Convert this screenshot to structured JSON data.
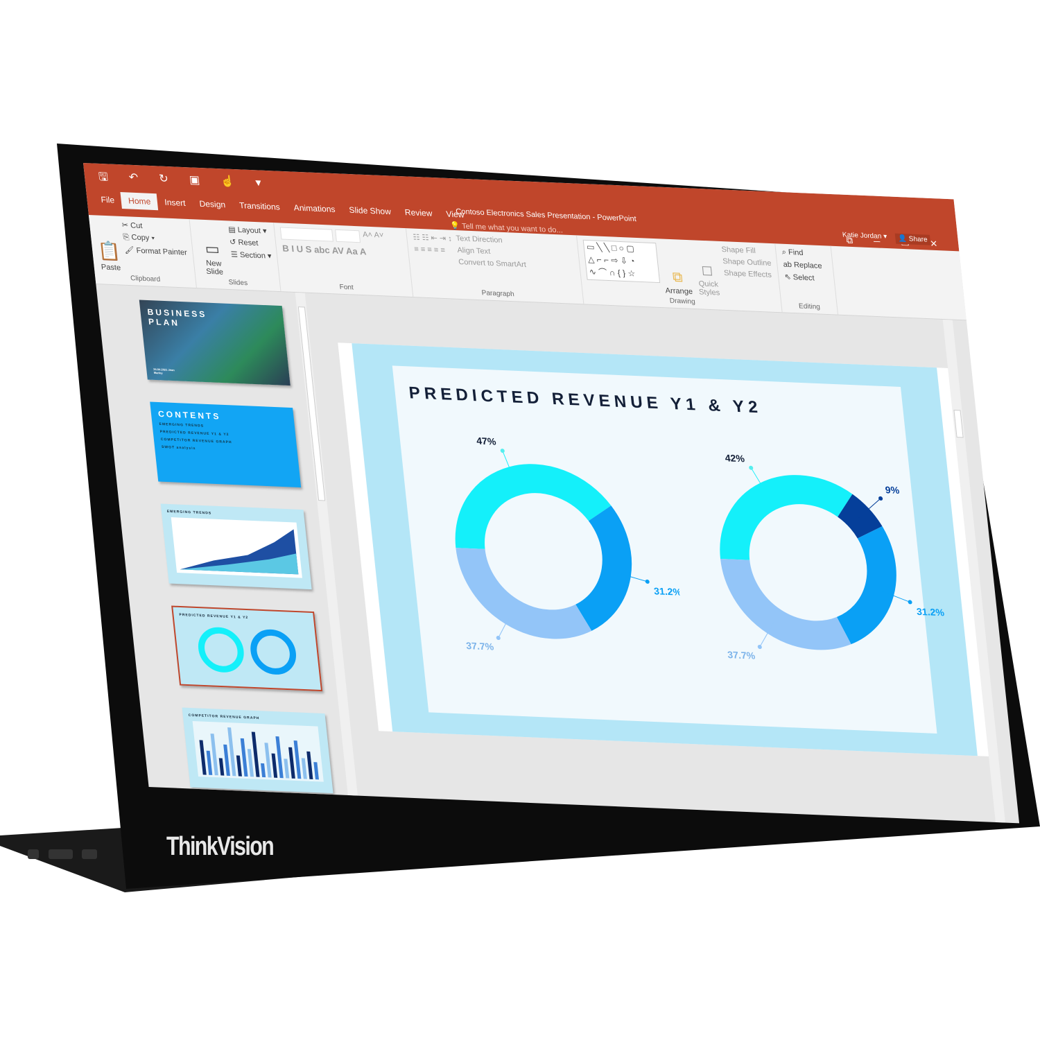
{
  "brand": {
    "logo_text": "ThinkVision"
  },
  "window": {
    "title": "Contoso Electronics Sales Presentation - PowerPoint",
    "user": "Katie Jordan",
    "share": "Share"
  },
  "quick_access": [
    "save-icon",
    "undo-icon",
    "redo-icon",
    "present-icon",
    "touch-mode-icon",
    "customize-icon"
  ],
  "tabs": [
    "File",
    "Home",
    "Insert",
    "Design",
    "Transitions",
    "Animations",
    "Slide Show",
    "Review",
    "View"
  ],
  "active_tab": "Home",
  "tell_me": "Tell me what you want to do...",
  "ribbon": {
    "clipboard": {
      "label": "Clipboard",
      "paste": "Paste",
      "cut": "Cut",
      "copy": "Copy",
      "format_painter": "Format Painter"
    },
    "slides": {
      "label": "Slides",
      "new_slide": "New Slide",
      "layout": "Layout",
      "reset": "Reset",
      "section": "Section"
    },
    "font": {
      "label": "Font",
      "buttons": "B I U S abc AV Aa A"
    },
    "paragraph": {
      "label": "Paragraph",
      "text_direction": "Text Direction",
      "align_text": "Align Text",
      "convert": "Convert to SmartArt"
    },
    "drawing": {
      "label": "Drawing",
      "arrange": "Arrange",
      "quick_styles": "Quick Styles",
      "shape_fill": "Shape Fill",
      "shape_outline": "Shape Outline",
      "shape_effects": "Shape Effects"
    },
    "editing": {
      "label": "Editing",
      "find": "Find",
      "replace": "Replace",
      "select": "Select"
    }
  },
  "thumbnails": [
    {
      "title": "BUSINESS PLAN",
      "sub": "24.04.2021 Jean Marley"
    },
    {
      "title": "CONTENTS",
      "items": [
        "EMERGING TRENDS",
        "PREDICTED REVENUE Y1 & Y2",
        "COMPETITOR REVENUE GRAPH",
        "SWOT analysis"
      ]
    },
    {
      "title": "EMERGING TRENDS"
    },
    {
      "title": "PREDICTED REVENUE Y1 & Y2"
    },
    {
      "title": "COMPETITOR REVENUE GRAPH"
    }
  ],
  "slide": {
    "title": "PREDICTED REVENUE Y1 & Y2"
  },
  "colors": {
    "cyan": "#14f0fa",
    "blue": "#0aa0f5",
    "light_blue": "#93c5f8",
    "navy": "#053f9a",
    "ribbon": "#c0462b"
  },
  "chart_data": [
    {
      "type": "pie",
      "categories": [
        "47%",
        "31.2%",
        "37.7%"
      ],
      "values": [
        47,
        31.2,
        37.7
      ],
      "colors": [
        "#14f0fa",
        "#0aa0f5",
        "#93c5f8"
      ]
    },
    {
      "type": "pie",
      "categories": [
        "42%",
        "9%",
        "31.2%",
        "37.7%"
      ],
      "values": [
        42,
        9,
        31.2,
        37.7
      ],
      "colors": [
        "#14f0fa",
        "#053f9a",
        "#0aa0f5",
        "#93c5f8"
      ]
    }
  ]
}
